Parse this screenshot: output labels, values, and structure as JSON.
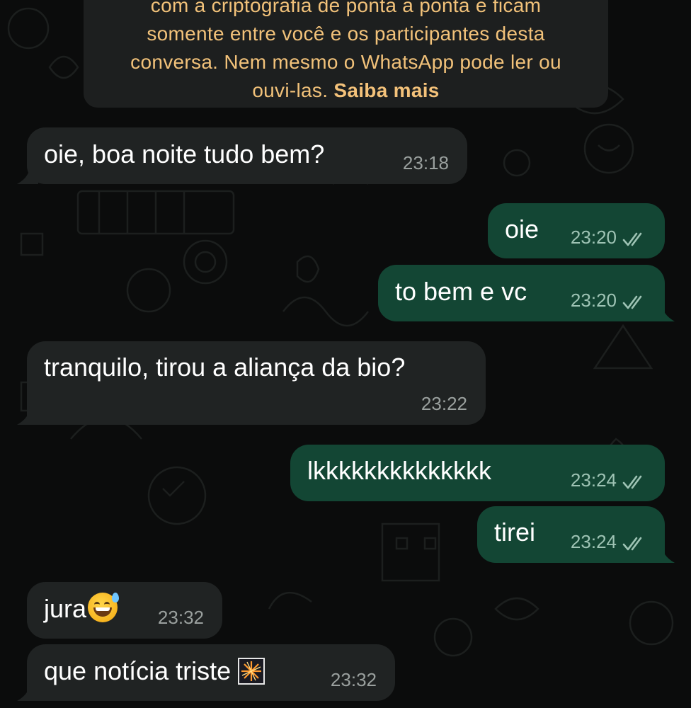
{
  "notice": {
    "line1": "com a criptografia de ponta a ponta e ficam",
    "line2": "somente entre você e os participantes desta",
    "line3": "conversa. Nem mesmo o WhatsApp pode ler ou",
    "line4": "ouvi-las.",
    "link": "Saiba mais"
  },
  "messages": [
    {
      "direction": "incoming",
      "text": "oie, boa noite tudo bem?",
      "time": "23:18"
    },
    {
      "direction": "outgoing",
      "text": "oie",
      "time": "23:20",
      "status": "read"
    },
    {
      "direction": "outgoing",
      "text": "to bem e vc",
      "time": "23:20",
      "status": "read"
    },
    {
      "direction": "incoming",
      "text": "tranquilo, tirou a aliança da bio?",
      "time": "23:22"
    },
    {
      "direction": "outgoing",
      "text": "lkkkkkkkkkkkkkk",
      "time": "23:24",
      "status": "read"
    },
    {
      "direction": "outgoing",
      "text": "tirei",
      "time": "23:24",
      "status": "read"
    },
    {
      "direction": "incoming",
      "text": "jura",
      "emoji": "grinning-face-with-sweat-emoji",
      "time": "23:32"
    },
    {
      "direction": "incoming",
      "text": "que notícia triste",
      "emoji": "fireworks-emoji",
      "time": "23:32"
    }
  ],
  "colors": {
    "background": "#0b0c0c",
    "incoming_bubble": "#202323",
    "outgoing_bubble": "#134634",
    "notice_bg": "#1d1f1f",
    "notice_text": "#f2c27a"
  }
}
